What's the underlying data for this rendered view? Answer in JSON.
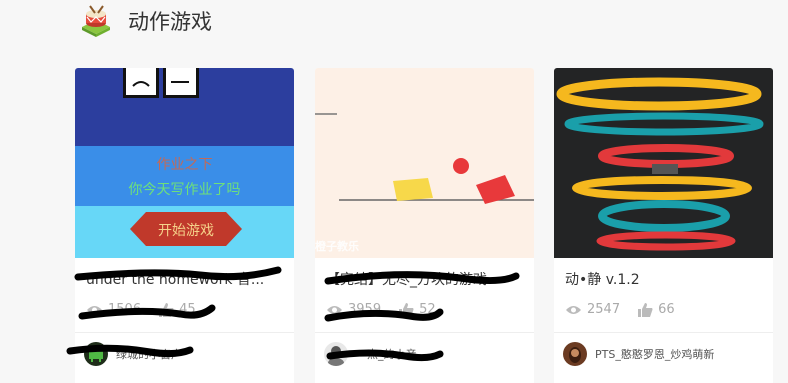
{
  "section": {
    "title": "动作游戏",
    "icon": "drum-icon"
  },
  "cards": [
    {
      "title": "under the homework 音...",
      "views": "1506",
      "likes": "45",
      "author": "绿城的小窗户",
      "thumbnail": {
        "line1": "作业之下",
        "line2": "你今天写作业了吗",
        "button": "开始游戏"
      }
    },
    {
      "title": "【完结】无尽_方块的游戏",
      "views": "3959",
      "likes": "52",
      "author": "一点_的小音",
      "thumbnail": {
        "watermark": "橙子教乐"
      }
    },
    {
      "title": "动•静 v.1.2",
      "views": "2547",
      "likes": "66",
      "author": "PTS_憨憨罗恩_炒鸡萌新"
    }
  ],
  "colors": {
    "stat_gray": "#aaaaaa",
    "ring_yellow": "#f5b81e",
    "ring_teal": "#1a9faa",
    "ring_red": "#e2393b"
  }
}
